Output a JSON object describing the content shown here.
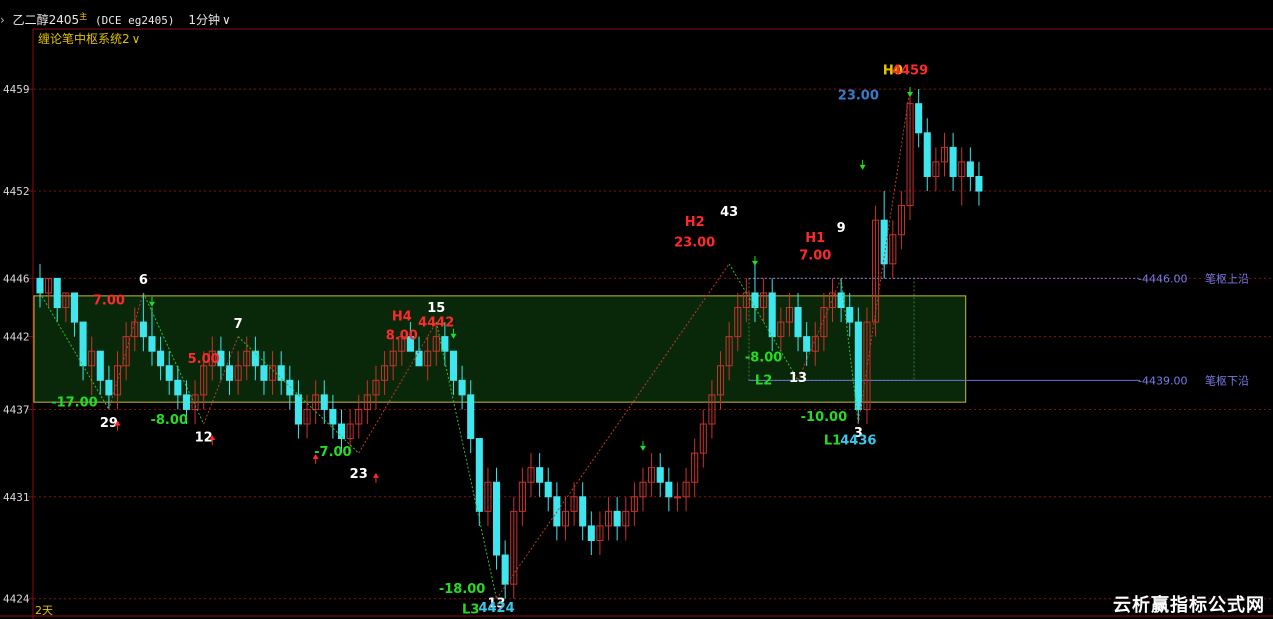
{
  "header": {
    "symbol_name": "乙二醇2405",
    "symbol_flag": "主",
    "exchange_code": "(DCE eg2405)",
    "period": "1分钟",
    "period_caret": "∨",
    "indicator": "缠论笔中枢系统2",
    "indicator_caret": "∨",
    "left_mark": "›"
  },
  "footer": {
    "days_label": "2天"
  },
  "watermark": "云析赢指标公式网",
  "colors": {
    "background": "#000000",
    "bull": "#c8322c",
    "bear": "#3fe6ee",
    "grid": "#8a1010",
    "zone_border": "#c7b83c",
    "zone_fill": "#0a2a0a",
    "label_red": "#ff2a2a",
    "label_green": "#22dd22",
    "label_white": "#ffffff",
    "label_yellow": "#e6c800",
    "label_cyan": "#39c6e8",
    "zone_line": "#6f6fd8"
  },
  "chart_data": {
    "type": "candlestick",
    "y_ticks": [
      4459,
      4452,
      4446,
      4442,
      4437,
      4431,
      4424
    ],
    "ylim": [
      4423.5,
      4461
    ],
    "x_range": [
      0,
      127
    ],
    "grid": true,
    "zones": [
      {
        "low": 4437.5,
        "high": 4444.8,
        "x_start": 0,
        "x_end": 107
      },
      {
        "low": 4439,
        "high": 4446,
        "x_start": 83,
        "x_end": 101
      }
    ],
    "zone_edge_lines": [
      {
        "value": 4446,
        "text": "-4446.00",
        "name": "笔枢上沿"
      },
      {
        "value": 4439,
        "text": "-4439.00",
        "name": "笔枢下沿"
      }
    ],
    "labels": [
      {
        "x": 12,
        "y": 4445.6,
        "text": "6",
        "color": "white"
      },
      {
        "x": 8,
        "y": 4444.2,
        "text": "7.00",
        "color": "red"
      },
      {
        "x": 4,
        "y": 4437.2,
        "text": "-17.00",
        "color": "green"
      },
      {
        "x": 8,
        "y": 4435.8,
        "text": "29",
        "color": "white"
      },
      {
        "x": 23,
        "y": 4442.6,
        "text": "7",
        "color": "white"
      },
      {
        "x": 19,
        "y": 4440.2,
        "text": "5.00",
        "color": "red"
      },
      {
        "x": 15,
        "y": 4436.0,
        "text": "-8.00",
        "color": "green"
      },
      {
        "x": 19,
        "y": 4434.8,
        "text": "12",
        "color": "white"
      },
      {
        "x": 34,
        "y": 4433.8,
        "text": "-7.00",
        "color": "green"
      },
      {
        "x": 37,
        "y": 4432.3,
        "text": "23",
        "color": "white"
      },
      {
        "x": 42,
        "y": 4443.1,
        "text": "H4",
        "color": "red"
      },
      {
        "x": 42,
        "y": 4441.8,
        "text": "8.00",
        "color": "red"
      },
      {
        "x": 46,
        "y": 4443.7,
        "text": "15",
        "color": "white"
      },
      {
        "x": 46,
        "y": 4442.7,
        "text": "4442",
        "color": "red"
      },
      {
        "x": 49,
        "y": 4424.4,
        "text": "-18.00",
        "color": "green"
      },
      {
        "x": 50,
        "y": 4423.0,
        "text": "L3",
        "color": "green"
      },
      {
        "x": 53,
        "y": 4423.4,
        "text": "13",
        "color": "white"
      },
      {
        "x": 53,
        "y": 4423.1,
        "text": "4424",
        "color": "cyan"
      },
      {
        "x": 76,
        "y": 4449.6,
        "text": "H2",
        "color": "red"
      },
      {
        "x": 76,
        "y": 4448.2,
        "text": "23.00",
        "color": "red"
      },
      {
        "x": 80,
        "y": 4450.3,
        "text": "43",
        "color": "white"
      },
      {
        "x": 84,
        "y": 4440.3,
        "text": "-8.00",
        "color": "green"
      },
      {
        "x": 84,
        "y": 4438.7,
        "text": "L2",
        "color": "green"
      },
      {
        "x": 88,
        "y": 4438.9,
        "text": "13",
        "color": "white"
      },
      {
        "x": 90,
        "y": 4448.5,
        "text": "H1",
        "color": "red"
      },
      {
        "x": 90,
        "y": 4447.3,
        "text": "7.00",
        "color": "red"
      },
      {
        "x": 93,
        "y": 4449.2,
        "text": "9",
        "color": "white"
      },
      {
        "x": 91,
        "y": 4436.2,
        "text": "-10.00",
        "color": "green"
      },
      {
        "x": 92,
        "y": 4434.6,
        "text": "L1",
        "color": "green"
      },
      {
        "x": 95,
        "y": 4435.1,
        "text": "3",
        "color": "white"
      },
      {
        "x": 95,
        "y": 4434.6,
        "text": "4436",
        "color": "cyan"
      },
      {
        "x": 99,
        "y": 4460.0,
        "text": "H0",
        "color": "yellow"
      },
      {
        "x": 101,
        "y": 4460.0,
        "text": "4459",
        "color": "red"
      },
      {
        "x": 95,
        "y": 4458.3,
        "text": "23.00",
        "color": "blue"
      }
    ],
    "arrows": [
      {
        "x": 13,
        "y": 4444.4,
        "dir": "down",
        "color": "green"
      },
      {
        "x": 9,
        "y": 4435.9,
        "dir": "up",
        "color": "red"
      },
      {
        "x": 20,
        "y": 4434.9,
        "dir": "up",
        "color": "red"
      },
      {
        "x": 32,
        "y": 4433.6,
        "dir": "up",
        "color": "red"
      },
      {
        "x": 39,
        "y": 4432.3,
        "dir": "up",
        "color": "red"
      },
      {
        "x": 48,
        "y": 4442.2,
        "dir": "down",
        "color": "green"
      },
      {
        "x": 70,
        "y": 4434.5,
        "dir": "down",
        "color": "green"
      },
      {
        "x": 83,
        "y": 4447.2,
        "dir": "down",
        "color": "green"
      },
      {
        "x": 95.5,
        "y": 4453.8,
        "dir": "down",
        "color": "green"
      },
      {
        "x": 101,
        "y": 4458.8,
        "dir": "down",
        "color": "green"
      }
    ],
    "candles": [
      [
        4446,
        4447,
        4444,
        4445
      ],
      [
        4445,
        4446,
        4444,
        4446
      ],
      [
        4446,
        4446,
        4443,
        4444
      ],
      [
        4444,
        4445,
        4443,
        4445
      ],
      [
        4445,
        4445,
        4442,
        4443
      ],
      [
        4443,
        4443,
        4439,
        4440
      ],
      [
        4440,
        4442,
        4438,
        4441
      ],
      [
        4441,
        4441,
        4438,
        4439
      ],
      [
        4439,
        4440,
        4437,
        4438
      ],
      [
        4438,
        4441,
        4437,
        4440
      ],
      [
        4440,
        4443,
        4439,
        4442
      ],
      [
        4442,
        4444,
        4441,
        4443
      ],
      [
        4443,
        4445,
        4441,
        4442
      ],
      [
        4442,
        4444,
        4440,
        4441
      ],
      [
        4441,
        4442,
        4439,
        4440
      ],
      [
        4440,
        4441,
        4438,
        4439
      ],
      [
        4439,
        4440,
        4437,
        4438
      ],
      [
        4438,
        4439,
        4436,
        4437
      ],
      [
        4437,
        4439,
        4436,
        4438
      ],
      [
        4438,
        4441,
        4437,
        4440
      ],
      [
        4440,
        4442,
        4439,
        4441
      ],
      [
        4441,
        4442,
        4439,
        4440
      ],
      [
        4440,
        4441,
        4438,
        4439
      ],
      [
        4439,
        4441,
        4438,
        4440
      ],
      [
        4440,
        4442,
        4439,
        4441
      ],
      [
        4441,
        4442,
        4439,
        4440
      ],
      [
        4440,
        4441,
        4438,
        4439
      ],
      [
        4439,
        4441,
        4438,
        4440
      ],
      [
        4440,
        4441,
        4438,
        4439
      ],
      [
        4439,
        4440,
        4437,
        4438
      ],
      [
        4438,
        4439,
        4435,
        4436
      ],
      [
        4436,
        4438,
        4435,
        4437
      ],
      [
        4437,
        4439,
        4436,
        4438
      ],
      [
        4438,
        4439,
        4436,
        4437
      ],
      [
        4437,
        4438,
        4435,
        4436
      ],
      [
        4436,
        4437,
        4434,
        4435
      ],
      [
        4435,
        4437,
        4434,
        4436
      ],
      [
        4436,
        4438,
        4435,
        4437
      ],
      [
        4437,
        4439,
        4436,
        4438
      ],
      [
        4438,
        4440,
        4437,
        4439
      ],
      [
        4439,
        4441,
        4438,
        4440
      ],
      [
        4440,
        4442,
        4439,
        4441
      ],
      [
        4441,
        4442,
        4440,
        4442
      ],
      [
        4442,
        4443,
        4441,
        4441
      ],
      [
        4441,
        4442,
        4440,
        4440
      ],
      [
        4440,
        4442,
        4439,
        4441
      ],
      [
        4441,
        4443,
        4440,
        4442
      ],
      [
        4442,
        4443,
        4440,
        4441
      ],
      [
        4441,
        4441,
        4438,
        4439
      ],
      [
        4439,
        4440,
        4437,
        4438
      ],
      [
        4438,
        4439,
        4434,
        4435
      ],
      [
        4435,
        4435,
        4429,
        4430
      ],
      [
        4430,
        4433,
        4429,
        4432
      ],
      [
        4432,
        4433,
        4426,
        4427
      ],
      [
        4427,
        4428,
        4424,
        4425
      ],
      [
        4425,
        4431,
        4424,
        4430
      ],
      [
        4430,
        4433,
        4429,
        4432
      ],
      [
        4432,
        4434,
        4431,
        4433
      ],
      [
        4433,
        4434,
        4431,
        4432
      ],
      [
        4432,
        4433,
        4430,
        4431
      ],
      [
        4431,
        4432,
        4428,
        4429
      ],
      [
        4429,
        4431,
        4428,
        4430
      ],
      [
        4430,
        4432,
        4429,
        4431
      ],
      [
        4431,
        4432,
        4428,
        4429
      ],
      [
        4429,
        4430,
        4427,
        4428
      ],
      [
        4428,
        4430,
        4427,
        4429
      ],
      [
        4429,
        4431,
        4428,
        4430
      ],
      [
        4430,
        4431,
        4428,
        4429
      ],
      [
        4429,
        4431,
        4428,
        4430
      ],
      [
        4430,
        4432,
        4429,
        4431
      ],
      [
        4431,
        4433,
        4430,
        4432
      ],
      [
        4432,
        4434,
        4431,
        4433
      ],
      [
        4433,
        4434,
        4431,
        4432
      ],
      [
        4432,
        4433,
        4430,
        4431
      ],
      [
        4431,
        4432,
        4430,
        4431
      ],
      [
        4431,
        4433,
        4430,
        4432
      ],
      [
        4432,
        4435,
        4431,
        4434
      ],
      [
        4434,
        4437,
        4433,
        4436
      ],
      [
        4436,
        4439,
        4435,
        4438
      ],
      [
        4438,
        4441,
        4437,
        4440
      ],
      [
        4440,
        4443,
        4439,
        4442
      ],
      [
        4442,
        4445,
        4441,
        4444
      ],
      [
        4444,
        4446,
        4443,
        4445
      ],
      [
        4445,
        4447,
        4443,
        4444
      ],
      [
        4444,
        4446,
        4443,
        4445
      ],
      [
        4445,
        4446,
        4441,
        4442
      ],
      [
        4442,
        4444,
        4441,
        4443
      ],
      [
        4443,
        4445,
        4442,
        4444
      ],
      [
        4444,
        4445,
        4441,
        4442
      ],
      [
        4442,
        4443,
        4440,
        4441
      ],
      [
        4441,
        4443,
        4440,
        4442
      ],
      [
        4442,
        4445,
        4441,
        4444
      ],
      [
        4444,
        4446,
        4443,
        4445
      ],
      [
        4445,
        4446,
        4443,
        4444
      ],
      [
        4444,
        4445,
        4442,
        4443
      ],
      [
        4443,
        4444,
        4436,
        4437
      ],
      [
        4437,
        4444,
        4436,
        4443
      ],
      [
        4443,
        4451,
        4442,
        4450
      ],
      [
        4450,
        4452,
        4446,
        4447
      ],
      [
        4447,
        4450,
        4446,
        4449
      ],
      [
        4449,
        4452,
        4448,
        4451
      ],
      [
        4451,
        4459,
        4450,
        4458
      ],
      [
        4458,
        4459,
        4455,
        4456
      ],
      [
        4456,
        4457,
        4452,
        4453
      ],
      [
        4453,
        4455,
        4452,
        4454
      ],
      [
        4454,
        4456,
        4453,
        4455
      ],
      [
        4455,
        4456,
        4452,
        4453
      ],
      [
        4453,
        4455,
        4451,
        4454
      ],
      [
        4454,
        4455,
        4452,
        4453
      ],
      [
        4453,
        4454,
        4451,
        4452
      ]
    ]
  }
}
